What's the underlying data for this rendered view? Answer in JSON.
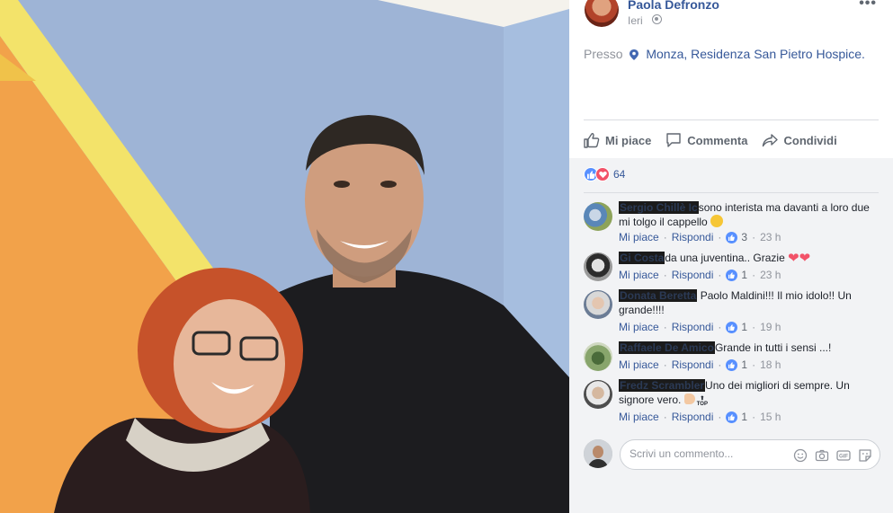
{
  "post": {
    "author": "Paola Defronzo",
    "time": "Ieri",
    "location_prefix": "Presso",
    "location": "Monza, Residenza San Pietro Hospice."
  },
  "actions": {
    "like": "Mi piace",
    "comment": "Commenta",
    "share": "Condividi"
  },
  "reactions": {
    "count": "64"
  },
  "comments": [
    {
      "name": "Sergio Chillè Ic",
      "text": "sono interista ma davanti a loro due mi tolgo il cappello",
      "likes": "3",
      "time": "23 h"
    },
    {
      "name": "Gi Costa",
      "text": "da una juventina.. Grazie",
      "likes": "1",
      "time": "23 h"
    },
    {
      "name": "Donata Beretta",
      "text": "Paolo Maldini!!! Il mio idolo!! Un grande!!!!",
      "likes": "1",
      "time": "19 h"
    },
    {
      "name": "Raffaele De Amico",
      "text": "Grande in tutti i sensi ...!",
      "likes": "1",
      "time": "18 h"
    },
    {
      "name": "Fredz Scrambler",
      "text": "Uno dei migliori di sempre. Un signore vero.",
      "likes": "1",
      "time": "15 h"
    }
  ],
  "comment_actions": {
    "like": "Mi piace",
    "reply": "Rispondi"
  },
  "composer": {
    "placeholder": "Scrivi un commento..."
  },
  "top_badge": "TOP",
  "colors": {
    "link": "#365899",
    "muted": "#90949c",
    "like_blue": "#5890ff",
    "love_red": "#f25268",
    "panel_bg": "#f2f3f5"
  }
}
